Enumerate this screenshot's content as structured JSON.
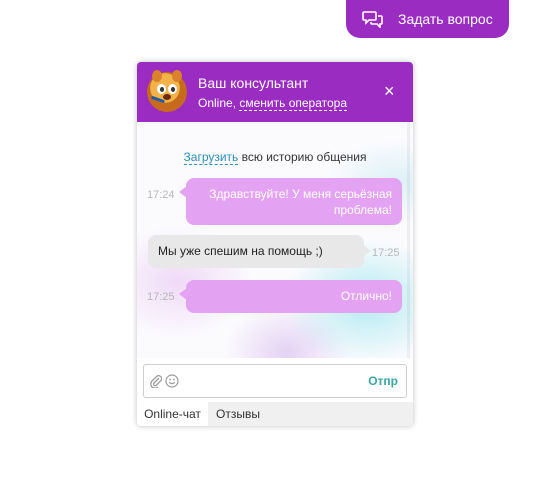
{
  "ask_button": {
    "label": "Задать вопрос",
    "icon": "chat-bubbles-icon"
  },
  "widget": {
    "header": {
      "title": "Ваш консультант",
      "status_prefix": "Online, ",
      "change_operator": "сменить оператора",
      "close_icon": "×"
    },
    "history": {
      "link": "Загрузить",
      "rest": " всю историю общения"
    },
    "messages": [
      {
        "from": "user",
        "time": "17:24",
        "text": "Здравствуйте! У меня серьёзная проблема!"
      },
      {
        "from": "operator",
        "time": "17:25",
        "text": "Мы уже спешим на помощь ;)"
      },
      {
        "from": "user",
        "time": "17:25",
        "text": "Отлично!"
      }
    ],
    "composer": {
      "attach_icon": "paperclip-icon",
      "emoji_icon": "smiley-icon",
      "input_value": "",
      "input_placeholder": "",
      "send_label": "Отпр"
    },
    "tabs": [
      {
        "label": "Online-чат",
        "active": true
      },
      {
        "label": "Отзывы",
        "active": false
      }
    ]
  },
  "colors": {
    "brand": "#9a2cc2",
    "user_bubble": "#e4a3f2",
    "operator_bubble": "#e8e8e8",
    "link": "#2a8fb8",
    "send": "#3aa6a0"
  }
}
